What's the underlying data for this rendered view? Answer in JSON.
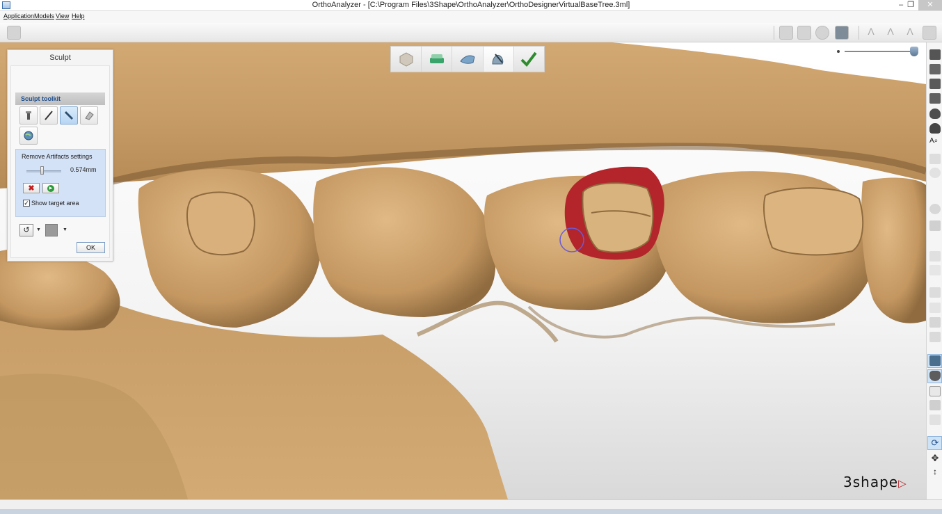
{
  "window": {
    "title": "OrthoAnalyzer - [C:\\Program Files\\3Shape\\OrthoAnalyzer\\OrthoDesignerVirtualBaseTree.3ml]",
    "minimize_icon": "minimize-icon",
    "maximize_icon": "maximize-icon",
    "close_icon": "close-icon"
  },
  "menu": {
    "items": [
      "Application",
      "Models",
      "View",
      "Help"
    ]
  },
  "workflow": {
    "steps": [
      {
        "icon": "model-cube-icon",
        "active": false
      },
      {
        "icon": "base-plate-icon",
        "active": false
      },
      {
        "icon": "trim-icon",
        "active": false
      },
      {
        "icon": "sculpt-icon",
        "active": true
      },
      {
        "icon": "checkmark-icon",
        "active": false
      }
    ]
  },
  "sculpt": {
    "title": "Sculpt",
    "toolkit_label": "Sculpt toolkit",
    "tools": [
      {
        "name": "wax-knife-tool",
        "selected": false
      },
      {
        "name": "smooth-tool",
        "selected": false
      },
      {
        "name": "remove-artifacts-tool",
        "selected": true
      },
      {
        "name": "add-remove-tool",
        "selected": false
      },
      {
        "name": "globe-tool",
        "selected": false
      }
    ],
    "settings": {
      "title": "Remove Artifacts settings",
      "value": "0.574mm",
      "slider_fraction": 0.45,
      "show_target_label": "Show target area",
      "show_target_checked": true
    },
    "ok_label": "OK"
  },
  "logo": {
    "text": "3shape"
  },
  "colors": {
    "model": "#c9a06a",
    "model_shadow": "#8a6a3e",
    "target_area": "#b3242b",
    "accent": "#2f6fb3"
  }
}
